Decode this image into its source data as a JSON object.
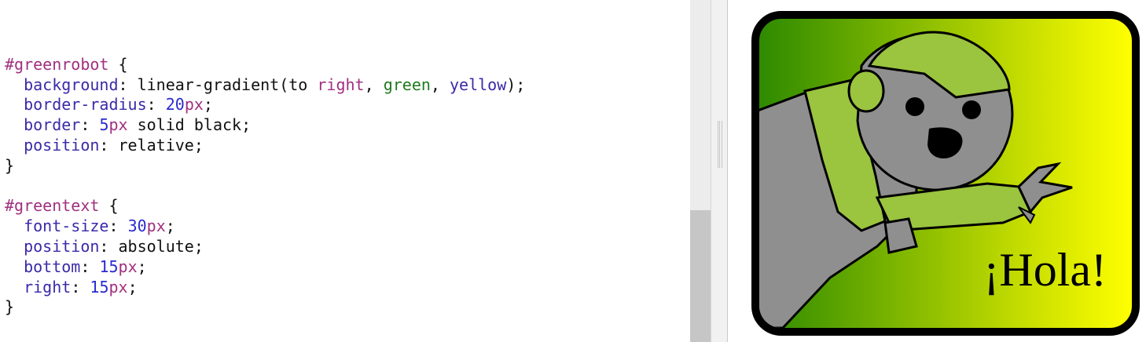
{
  "editor": {
    "lines": [
      {
        "t": ""
      },
      {
        "segments": [
          [
            "sel",
            "#greenrobot"
          ],
          [
            "punc",
            " {"
          ]
        ]
      },
      {
        "segments": [
          [
            "punc",
            "  "
          ],
          [
            "prop",
            "background"
          ],
          [
            "punc",
            ": linear-gradient(to "
          ],
          [
            "kw",
            "right"
          ],
          [
            "punc",
            ", "
          ],
          [
            "green-kw",
            "green"
          ],
          [
            "punc",
            ", "
          ],
          [
            "prop",
            "yellow"
          ],
          [
            "punc",
            ");"
          ]
        ]
      },
      {
        "segments": [
          [
            "punc",
            "  "
          ],
          [
            "prop",
            "border-radius"
          ],
          [
            "punc",
            ": "
          ],
          [
            "num",
            "20"
          ],
          [
            "unit",
            "px"
          ],
          [
            "punc",
            ";"
          ]
        ]
      },
      {
        "segments": [
          [
            "punc",
            "  "
          ],
          [
            "prop",
            "border"
          ],
          [
            "punc",
            ": "
          ],
          [
            "num",
            "5"
          ],
          [
            "unit",
            "px"
          ],
          [
            "punc",
            " solid black;"
          ]
        ]
      },
      {
        "segments": [
          [
            "punc",
            "  "
          ],
          [
            "prop",
            "position"
          ],
          [
            "punc",
            ": relative;"
          ]
        ]
      },
      {
        "segments": [
          [
            "punc",
            "}"
          ]
        ]
      },
      {
        "t": ""
      },
      {
        "segments": [
          [
            "sel",
            "#greentext"
          ],
          [
            "punc",
            " {"
          ]
        ]
      },
      {
        "segments": [
          [
            "punc",
            "  "
          ],
          [
            "prop",
            "font-size"
          ],
          [
            "punc",
            ": "
          ],
          [
            "num",
            "30"
          ],
          [
            "unit",
            "px"
          ],
          [
            "punc",
            ";"
          ]
        ]
      },
      {
        "segments": [
          [
            "punc",
            "  "
          ],
          [
            "prop",
            "position"
          ],
          [
            "punc",
            ": absolute;"
          ]
        ]
      },
      {
        "segments": [
          [
            "punc",
            "  "
          ],
          [
            "prop",
            "bottom"
          ],
          [
            "punc",
            ": "
          ],
          [
            "num",
            "15"
          ],
          [
            "unit",
            "px"
          ],
          [
            "punc",
            ";"
          ]
        ]
      },
      {
        "segments": [
          [
            "punc",
            "  "
          ],
          [
            "prop",
            "right"
          ],
          [
            "punc",
            ": "
          ],
          [
            "num",
            "15"
          ],
          [
            "unit",
            "px"
          ],
          [
            "punc",
            ";"
          ]
        ]
      },
      {
        "segments": [
          [
            "punc",
            "}"
          ]
        ]
      }
    ]
  },
  "preview": {
    "greentext": "¡Hola!",
    "robot_image": "green-robot-illustration"
  },
  "colors": {
    "selector": "#a0307f",
    "property": "#3a2aa8",
    "number": "#2a2ad0",
    "gradient_start": "#2e8a00",
    "gradient_end": "#ffff00",
    "robot_green": "#9bc43f",
    "robot_gray": "#8f8f8f"
  }
}
